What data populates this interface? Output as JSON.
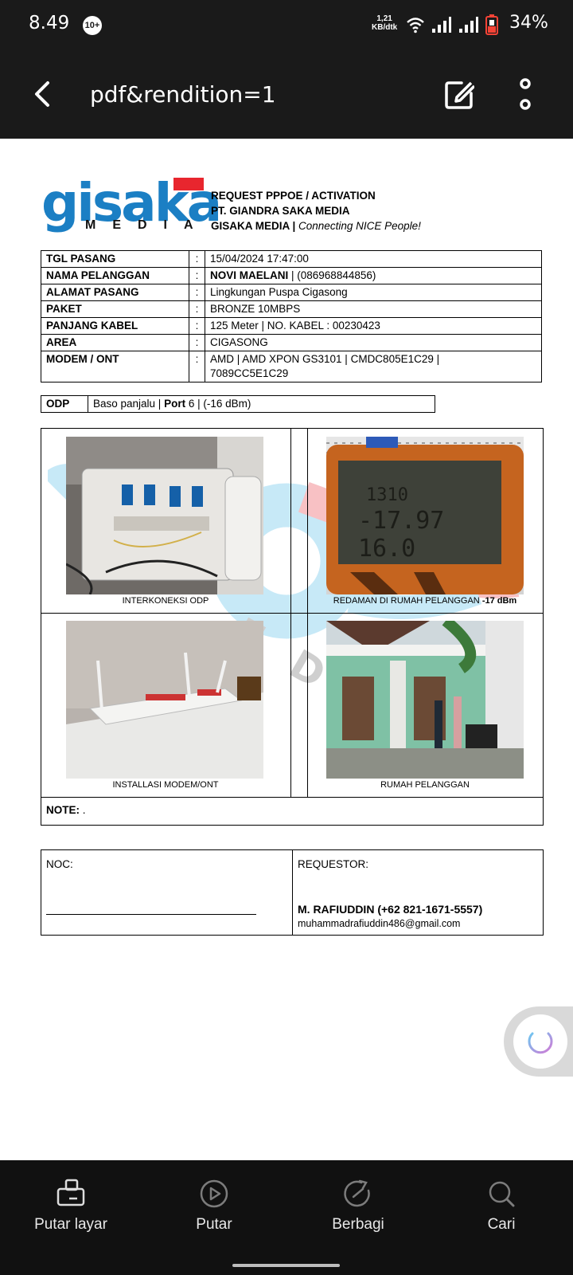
{
  "status_bar": {
    "time": "8.49",
    "notif_badge": "10+",
    "speed_value": "1,21",
    "speed_unit": "KB/dtk",
    "battery_pct": "34%",
    "icons": [
      "wifi-icon",
      "signal-icon",
      "signal-icon",
      "battery-icon"
    ]
  },
  "app_bar": {
    "title": "pdf&rendition=1",
    "icons": [
      "back-arrow-icon",
      "edit-icon",
      "more-vertical-icon"
    ]
  },
  "document": {
    "logo_text": "gisaka",
    "logo_sub": "MEDIA",
    "header": {
      "line1": "REQUEST PPPOE / ACTIVATION",
      "line2": "PT. GIANDRA SAKA MEDIA",
      "line3_bold": "GISAKA MEDIA | ",
      "line3_italic": "Connecting NICE People!"
    },
    "info_rows": [
      {
        "key": "TGL PASANG",
        "value": "15/04/2024 17:47:00"
      },
      {
        "key": "NAMA PELANGGAN",
        "value_bold": "NOVI MAELANI",
        "value": " | (086968844856)"
      },
      {
        "key": "ALAMAT PASANG",
        "value": "Lingkungan Puspa Cigasong"
      },
      {
        "key": "PAKET",
        "value": "BRONZE 10MBPS"
      },
      {
        "key": "PANJANG KABEL",
        "value": "125  Meter  | NO. KABEL : 00230423"
      },
      {
        "key": "AREA",
        "value": "CIGASONG"
      },
      {
        "key": "MODEM / ONT",
        "value": "AMD  |  AMD XPON GS3101 | CMDC805E1C29 |",
        "value2": "7089CC5E1C29"
      }
    ],
    "separator": ":",
    "odp": {
      "key": "ODP",
      "value1": "Baso panjalu | ",
      "port_label": "Port",
      "port_value": " 6 |  (-16 dBm)"
    },
    "photos": [
      {
        "caption": "INTERKONEKSI ODP"
      },
      {
        "caption": "REDAMAN DI RUMAH PELANGGAN ",
        "caption_bold": "-17 dBm"
      },
      {
        "caption": "INSTALLASI MODEM/ONT"
      },
      {
        "caption": "RUMAH PELANGGAN"
      }
    ],
    "meter_readings": [
      "1310",
      "-17.97",
      "16.0"
    ],
    "note_label": "NOTE:",
    "note_value": " .",
    "noc_label": "NOC:",
    "requestor_label": "REQUESTOR:",
    "requestor_name": "M. RAFIUDDIN (+62 821-1671-5557)",
    "requestor_email": "muhammadrafiuddin486@gmail.com"
  },
  "bottom_bar": [
    {
      "label": "Putar layar",
      "icon": "rotate-screen-icon"
    },
    {
      "label": "Putar",
      "icon": "play-icon"
    },
    {
      "label": "Berbagi",
      "icon": "share-icon"
    },
    {
      "label": "Cari",
      "icon": "search-icon"
    }
  ],
  "colors": {
    "brand_blue": "#1b7fc4",
    "brand_red": "#e8262e",
    "chrome": "#1a1a1a"
  }
}
